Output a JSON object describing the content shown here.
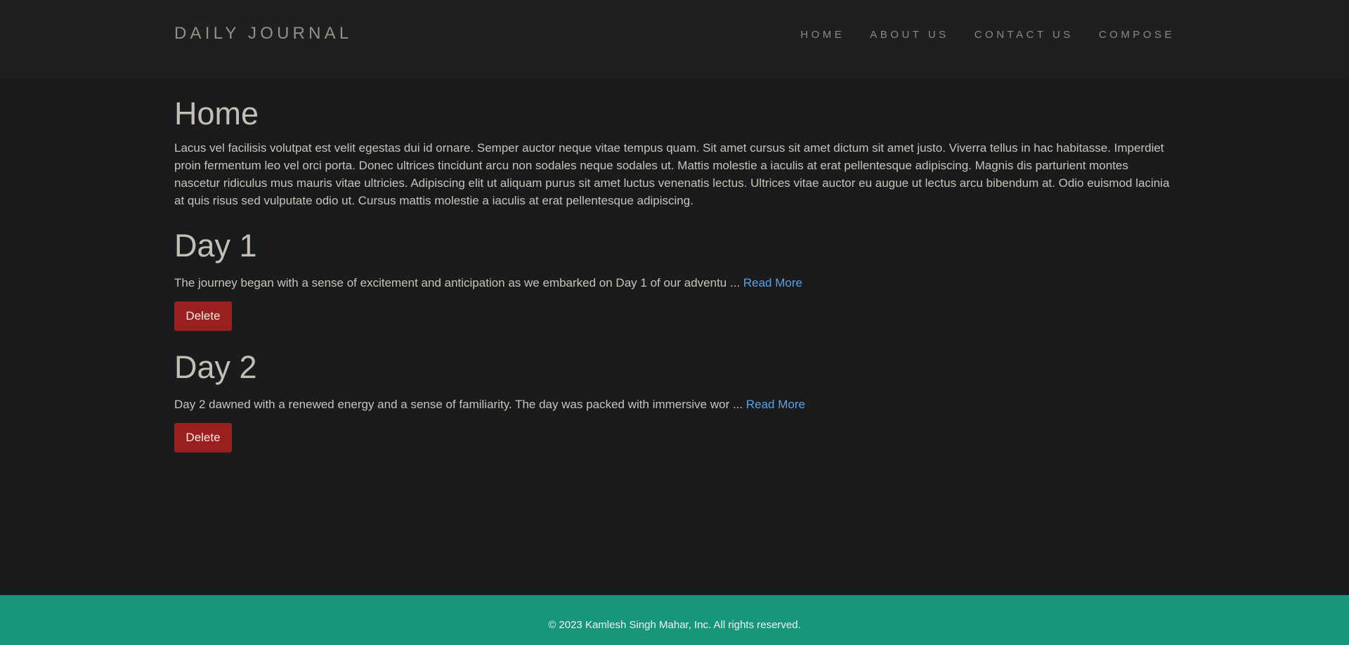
{
  "navbar": {
    "brand": "DAILY JOURNAL",
    "links": [
      {
        "label": "HOME"
      },
      {
        "label": "ABOUT US"
      },
      {
        "label": "CONTACT US"
      },
      {
        "label": "COMPOSE"
      }
    ]
  },
  "main": {
    "title": "Home",
    "intro": "Lacus vel facilisis volutpat est velit egestas dui id ornare. Semper auctor neque vitae tempus quam. Sit amet cursus sit amet dictum sit amet justo. Viverra tellus in hac habitasse. Imperdiet proin fermentum leo vel orci porta. Donec ultrices tincidunt arcu non sodales neque sodales ut. Mattis molestie a iaculis at erat pellentesque adipiscing. Magnis dis parturient montes nascetur ridiculus mus mauris vitae ultricies. Adipiscing elit ut aliquam purus sit amet luctus venenatis lectus. Ultrices vitae auctor eu augue ut lectus arcu bibendum at. Odio euismod lacinia at quis risus sed vulputate odio ut. Cursus mattis molestie a iaculis at erat pellentesque adipiscing.",
    "posts": [
      {
        "title": "Day 1",
        "excerpt": "The journey began with a sense of excitement and anticipation as we embarked on Day 1 of our adventu ... ",
        "read_more": "Read More",
        "delete_label": "Delete"
      },
      {
        "title": "Day 2",
        "excerpt": "Day 2 dawned with a renewed energy and a sense of familiarity. The day was packed with immersive wor ... ",
        "read_more": "Read More",
        "delete_label": "Delete"
      }
    ]
  },
  "footer": {
    "text": "© 2023 Kamlesh Singh Mahar, Inc. All rights reserved."
  },
  "colors": {
    "background": "#1a1b1d",
    "navbar": "#1e1f21",
    "link": "#5aa2e6",
    "delete_button": "#9a2020",
    "footer": "#17967a"
  }
}
